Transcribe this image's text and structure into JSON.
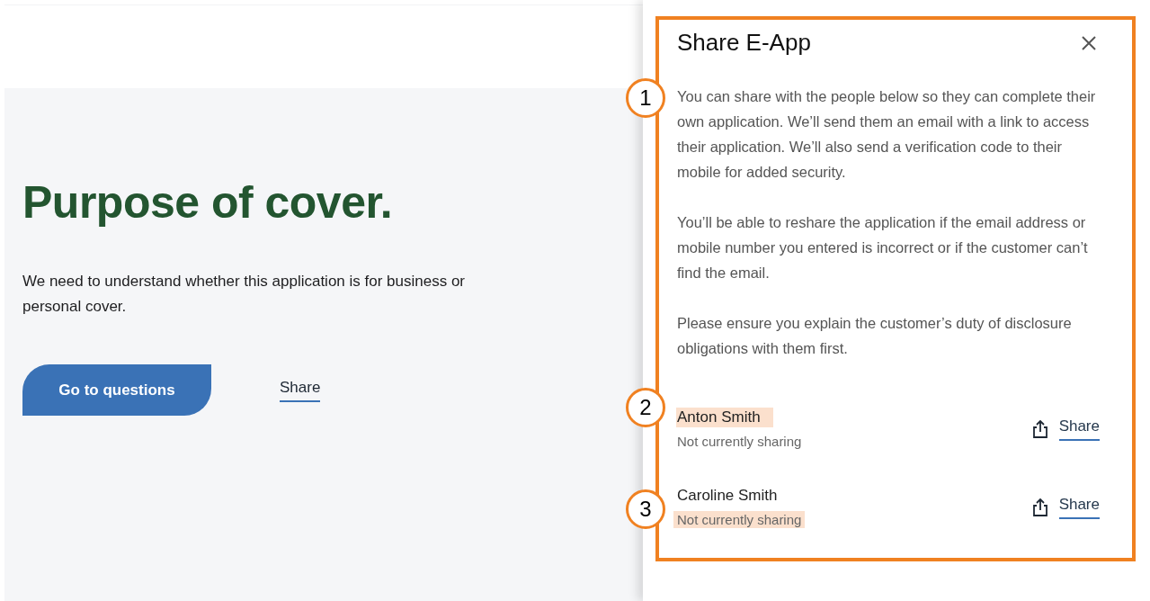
{
  "page": {
    "title": "Purpose of cover.",
    "description": "We need to understand whether this application is for business or personal cover.",
    "primary_button": "Go to questions",
    "share_link": "Share"
  },
  "drawer": {
    "title": "Share E-App",
    "callout": "1",
    "paragraphs": [
      "You can share with the people below so they can complete their own application. We’ll send them an email with a link to access their application. We’ll also send a verification code to their mobile for added security.",
      "You’ll be able to reshare the application if the email address or mobile number you entered is incorrect or if the customer can’t find the email.",
      "Please ensure you explain the customer’s duty of disclosure obligations with them first."
    ],
    "people": [
      {
        "name": "Anton Smith",
        "status": "Not currently sharing",
        "name_highlighted": true,
        "status_highlighted": false,
        "action": "Share",
        "callout": "2"
      },
      {
        "name": "Caroline Smith",
        "status": "Not currently sharing",
        "name_highlighted": false,
        "status_highlighted": true,
        "action": "Share",
        "callout": "3"
      }
    ]
  }
}
